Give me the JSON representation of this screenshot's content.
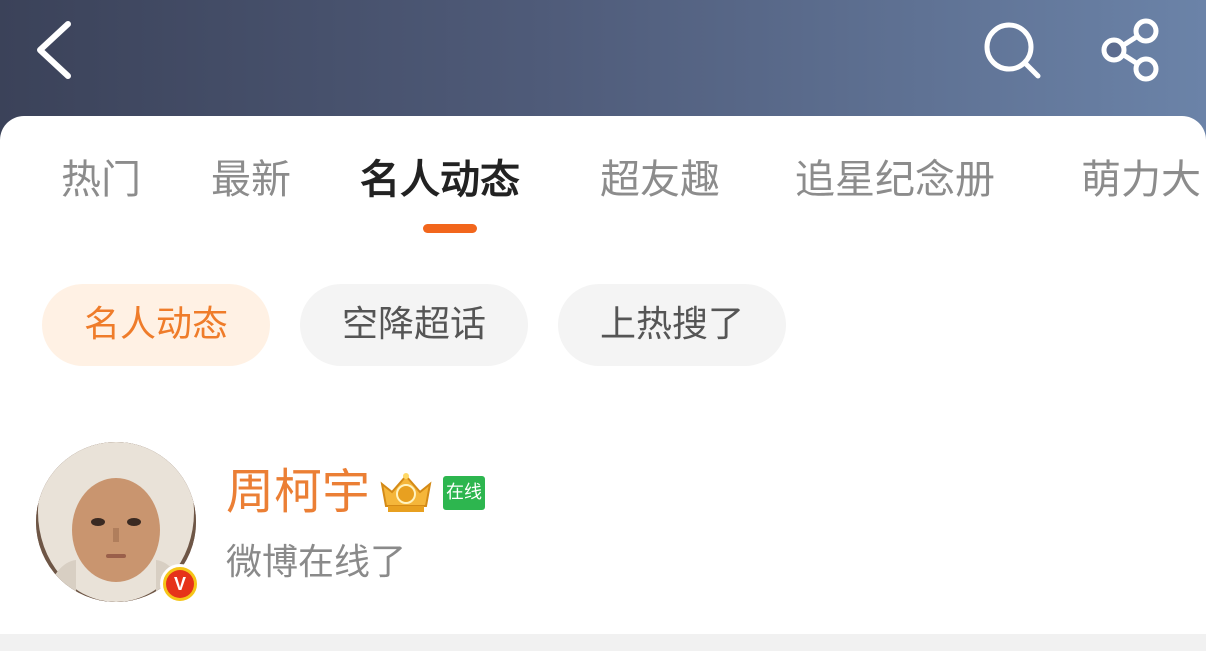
{
  "header": {
    "title": "",
    "back_icon": "chevron-left-icon",
    "search_icon": "search-icon",
    "share_icon": "share-icon"
  },
  "tabs": [
    {
      "label": "热门",
      "active": false
    },
    {
      "label": "最新",
      "active": false
    },
    {
      "label": "名人动态",
      "active": true
    },
    {
      "label": "超友趣",
      "active": false
    },
    {
      "label": "追星纪念册",
      "active": false
    },
    {
      "label": "萌力大",
      "active": false
    }
  ],
  "chips": [
    {
      "label": "名人动态",
      "active": true
    },
    {
      "label": "空降超话",
      "active": false
    },
    {
      "label": "上热搜了",
      "active": false
    }
  ],
  "post": {
    "user_name": "周柯宇",
    "badge_icon": "crown-badge-icon",
    "online_tag": "在线",
    "status_text": "微博在线了",
    "verified_mark": "V"
  },
  "colors": {
    "accent": "#f2661c",
    "chip_active_text": "#ef7c2a",
    "chip_active_bg": "#fff1e4",
    "username": "#eb7f35",
    "online_green": "#2db64f"
  }
}
